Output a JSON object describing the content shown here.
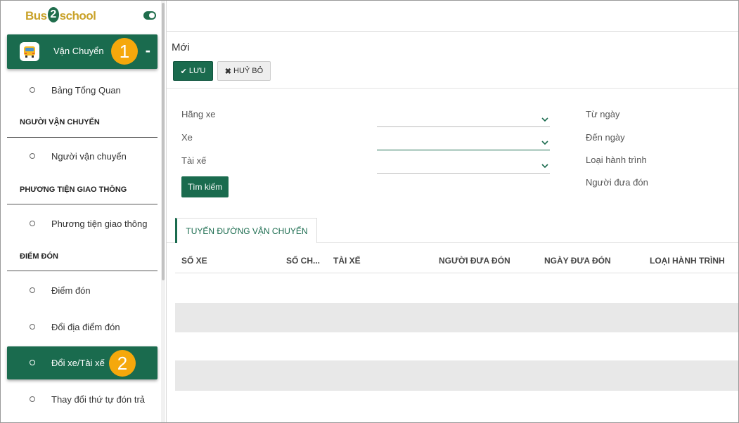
{
  "logo": {
    "part1": "Bus",
    "part2": "2",
    "part3": "school"
  },
  "sidebar": {
    "main_item": {
      "label": "Vận Chuyển",
      "badge": "1",
      "collapse": "-"
    },
    "items": [
      {
        "label": "Bảng Tổng Quan"
      },
      {
        "section": "NGƯỜI VẬN CHUYỂN"
      },
      {
        "label": "Người vận chuyển"
      },
      {
        "section": "PHƯƠNG TIỆN GIAO THÔNG"
      },
      {
        "label": "Phương tiện giao thông"
      },
      {
        "section": "ĐIỂM ĐÓN"
      },
      {
        "label": "Điểm đón"
      },
      {
        "label": "Đổi địa điểm đón"
      },
      {
        "label": "Đổi xe/Tài xế",
        "badge": "2"
      },
      {
        "label": "Thay đổi thứ tự đón trả"
      }
    ]
  },
  "main": {
    "title": "Mới",
    "save_label": "LƯU",
    "cancel_label": "HUỶ BỎ",
    "form": {
      "hang_xe": "Hãng xe",
      "xe": "Xe",
      "tai_xe": "Tài xế",
      "tu_ngay": "Từ ngày",
      "den_ngay": "Đến ngày",
      "loai_hanh_trinh": "Loại hành trình",
      "nguoi_dua_don": "Người đưa đón"
    },
    "search_label": "Tìm kiếm",
    "tab_label": "TUYẾN ĐƯỜNG VẬN CHUYỂN",
    "columns": [
      "SỐ XE",
      "SỐ CH...",
      "TÀI XẾ",
      "NGƯỜI ĐƯA ĐÓN",
      "NGÀY ĐƯA ĐÓN",
      "LOẠI HÀNH TRÌNH"
    ]
  },
  "colors": {
    "primary": "#1a6b4e",
    "badge": "#f5a80c"
  }
}
